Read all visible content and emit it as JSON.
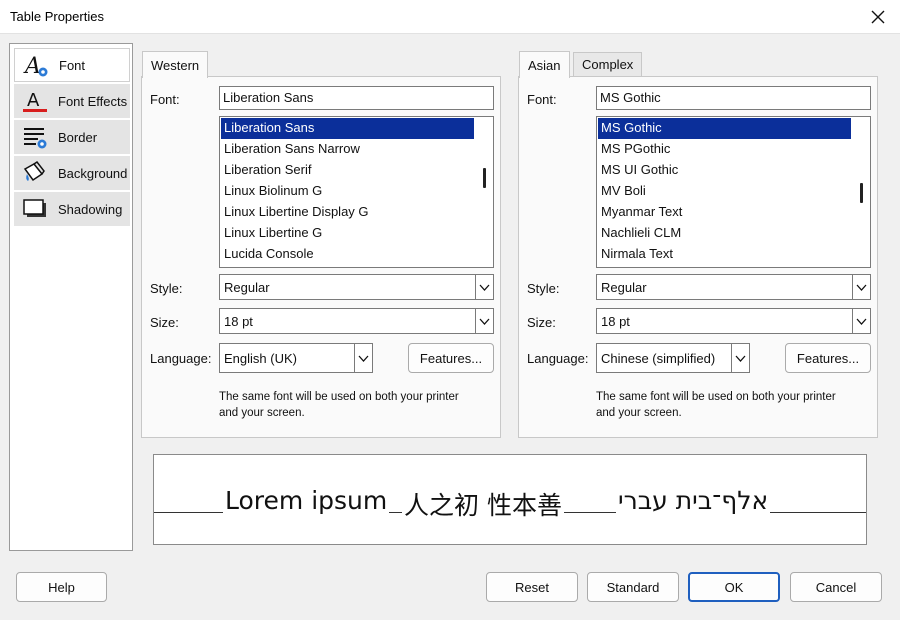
{
  "window": {
    "title": "Table Properties"
  },
  "sidebar": {
    "items": [
      {
        "label": "Font",
        "icon": "font-icon"
      },
      {
        "label": "Font Effects",
        "icon": "font-effects-icon"
      },
      {
        "label": "Border",
        "icon": "border-icon"
      },
      {
        "label": "Background",
        "icon": "background-icon"
      },
      {
        "label": "Shadowing",
        "icon": "shadowing-icon"
      }
    ]
  },
  "western": {
    "tab": "Western",
    "font_label": "Font:",
    "font_value": "Liberation Sans",
    "font_list": [
      "Liberation Sans",
      "Liberation Sans Narrow",
      "Liberation Serif",
      "Linux Biolinum G",
      "Linux Libertine Display G",
      "Linux Libertine G",
      "Lucida Console"
    ],
    "style_label": "Style:",
    "style_value": "Regular",
    "size_label": "Size:",
    "size_value": "18 pt",
    "language_label": "Language:",
    "language_value": "English (UK)",
    "features_button": "Features...",
    "note_line1": "The same font will be used on both your printer",
    "note_line2": "and your screen."
  },
  "asian": {
    "tab_active": "Asian",
    "tab_other": "Complex",
    "font_label": "Font:",
    "font_value": "MS Gothic",
    "font_list": [
      "MS Gothic",
      "MS PGothic",
      "MS UI Gothic",
      "MV Boli",
      "Myanmar Text",
      "Nachlieli CLM",
      "Nirmala Text"
    ],
    "style_label": "Style:",
    "style_value": "Regular",
    "size_label": "Size:",
    "size_value": "18 pt",
    "language_label": "Language:",
    "language_value": "Chinese (simplified)",
    "features_button": "Features...",
    "note_line1": "The same font will be used on both your printer",
    "note_line2": "and your screen."
  },
  "preview": {
    "western_text": "Lorem ipsum",
    "asian_text": "人之初 性本善",
    "complex_text": "אלף־בית עברי"
  },
  "footer": {
    "help": "Help",
    "reset": "Reset",
    "standard": "Standard",
    "ok": "OK",
    "cancel": "Cancel"
  },
  "colors": {
    "selection": "#0b2f9a",
    "default_button_border": "#1f5fbf",
    "font_effects_underline": "#d81e1e",
    "icon_blue": "#2c7bd6"
  }
}
